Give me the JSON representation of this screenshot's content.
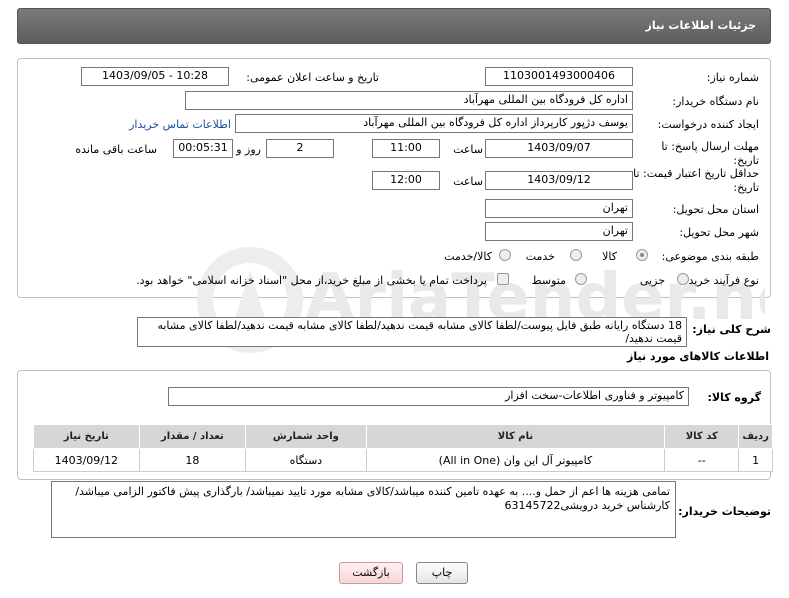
{
  "header": {
    "title": "جزئیات اطلاعات نیاز"
  },
  "form": {
    "need_number_label": "شماره نیاز:",
    "need_number": "1103001493000406",
    "announce_label": "تاریخ و ساعت اعلان عمومی:",
    "announce_value": "1403/09/05 - 10:28",
    "buyer_org_label": "نام دستگاه خریدار:",
    "buyer_org": "اداره کل فرودگاه بین المللی مهرآباد",
    "requester_label": "ایجاد کننده درخواست:",
    "requester": "یوسف دژپور کارپرداز اداره کل فرودگاه بین المللی مهرآباد",
    "contact_link": "اطلاعات تماس خریدار",
    "deadline_label_1": "مهلت ارسال پاسخ: تا",
    "deadline_label_2": "تاریخ:",
    "deadline_date": "1403/09/07",
    "hour_label": "ساعت",
    "deadline_time": "11:00",
    "days_value": "2",
    "days_label": "روز و",
    "remaining_time": "00:05:31",
    "remaining_label": "ساعت باقی مانده",
    "validity_label_1": "حداقل تاریخ اعتبار قیمت: تا",
    "validity_label_2": "تاریخ:",
    "validity_date": "1403/09/12",
    "validity_hour_label": "ساعت",
    "validity_time": "12:00",
    "province_label": "استان محل تحویل:",
    "province": "تهران",
    "city_label": "شهر محل تحویل:",
    "city": "تهران",
    "category_label": "طبقه بندی موضوعی:",
    "category_options": [
      "کالا",
      "خدمت",
      "کالا/خدمت"
    ],
    "purchase_type_label": "نوع فرآیند خرید :",
    "purchase_options": [
      "جزیی",
      "متوسط"
    ],
    "payment_note": "پرداخت تمام یا بخشی از مبلغ خرید،از محل \"اسناد خزانه اسلامی\" خواهد بود."
  },
  "description": {
    "label": "شرح کلی نیاز:",
    "text": "18 دستگاه رایانه طبق فایل پیوست/لطفا کالای مشابه قیمت ندهید/لطفا کالای مشابه قیمت ندهید/لطفا کالای مشابه قیمت ندهید/"
  },
  "goods": {
    "section_title": "اطلاعات کالاهای مورد نیاز",
    "group_label": "گروه کالا:",
    "group_value": "کامپیوتر و فناوری اطلاعات-سخت افزار",
    "columns": [
      "ردیف",
      "کد کالا",
      "نام کالا",
      "واحد شمارش",
      "تعداد / مقدار",
      "تاریخ نیاز"
    ],
    "rows": [
      [
        "1",
        "--",
        "کامپیوتر آل این وان (All in One)",
        "دستگاه",
        "18",
        "1403/09/12"
      ]
    ]
  },
  "buyer_notes": {
    "label": "توضیحات خریدار:",
    "text": "تمامی هزینه ها اعم از حمل و.... به عهده تامین کننده میباشد/کالای مشابه مورد تایید نمیباشد/ بارگذاری پیش فاکتور الزامی میباشد/کارشناس خرید درویشی63145722"
  },
  "buttons": {
    "print": "چاپ",
    "back": "بازگشت"
  },
  "watermark": {
    "text": "AriaTender.net"
  },
  "colors": {
    "header_bg": "#666666",
    "link": "#1a4fa0",
    "table_header": "#d6d6d6"
  }
}
